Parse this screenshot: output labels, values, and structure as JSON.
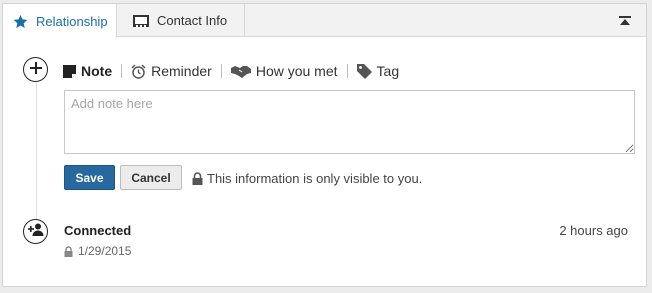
{
  "tabs": [
    {
      "label": "Relationship",
      "icon": "star-icon",
      "active": true
    },
    {
      "label": "Contact Info",
      "icon": "address-card-icon",
      "active": false
    }
  ],
  "collapse_icon": "collapse-icon",
  "actions": [
    {
      "label": "Note",
      "icon": "note-icon"
    },
    {
      "label": "Reminder",
      "icon": "alarm-clock-icon"
    },
    {
      "label": "How you met",
      "icon": "handshake-icon"
    },
    {
      "label": "Tag",
      "icon": "tag-icon"
    }
  ],
  "note": {
    "placeholder": "Add note here",
    "value": ""
  },
  "buttons": {
    "save": "Save",
    "cancel": "Cancel"
  },
  "privacy_text": "This information is only visible to you.",
  "connection": {
    "title": "Connected",
    "date": "1/29/2015",
    "time_ago": "2 hours ago"
  },
  "colors": {
    "accent": "#1a6fa8",
    "save_button": "#27689f"
  }
}
